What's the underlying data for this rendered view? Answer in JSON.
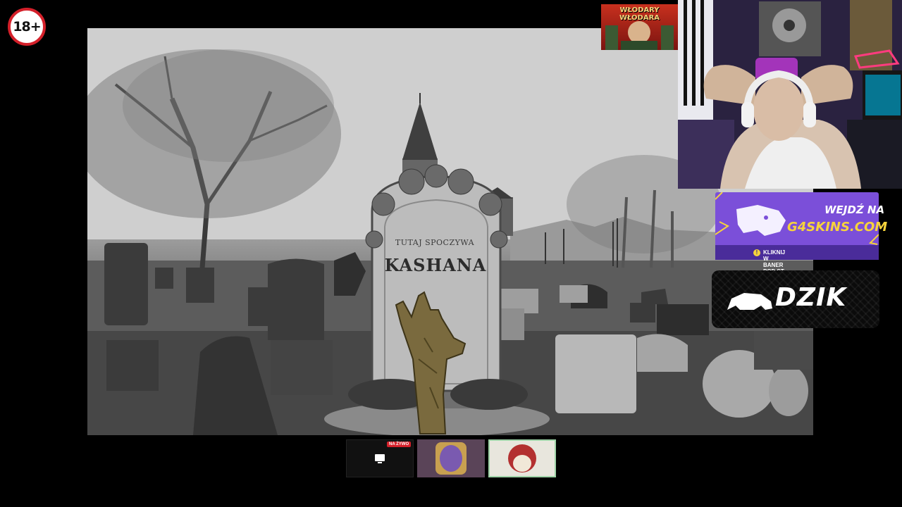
{
  "badge": {
    "age_label": "18+"
  },
  "scene": {
    "tombstone_epitaph": "TUTAJ SPOCZYWA",
    "tombstone_name": "KASHANA"
  },
  "promo_banner": {
    "line1": "WŁODARY",
    "line2": "WŁODARA"
  },
  "g4skins": {
    "title": "WEJDŹ NA",
    "domain": "G4SKINS.COM",
    "cta": "KLIKNIJ W BANER POD ST",
    "info_icon": "info-icon",
    "logo_icon": "panther-head-icon"
  },
  "dzik": {
    "brand": "DZIK",
    "logo_icon": "boar-icon"
  },
  "thumbnails": {
    "live_badge": "NA ŻYWO",
    "screen_icon": "monitor-icon"
  },
  "colors": {
    "age_border": "#d4202a",
    "g4_purple": "#7b4fd9",
    "g4_yellow": "#f6d33c",
    "live_red": "#d4202a"
  }
}
